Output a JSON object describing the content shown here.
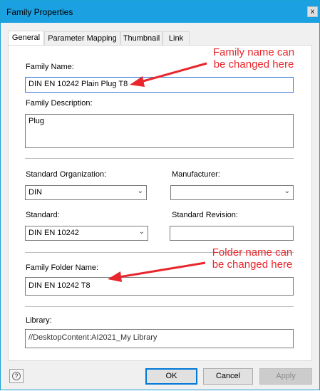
{
  "window": {
    "title": "Family Properties",
    "close_glyph": "x"
  },
  "tabs": [
    {
      "label": "General",
      "active": true
    },
    {
      "label": "Parameter Mapping",
      "active": false
    },
    {
      "label": "Thumbnail",
      "active": false
    },
    {
      "label": "Link",
      "active": false
    }
  ],
  "general": {
    "family_name_label": "Family Name:",
    "family_name_value": "DIN EN 10242 Plain Plug T8",
    "family_description_label": "Family Description:",
    "family_description_value": "Plug",
    "standard_org_label": "Standard Organization:",
    "standard_org_value": "DIN",
    "manufacturer_label": "Manufacturer:",
    "manufacturer_value": "",
    "standard_label": "Standard:",
    "standard_value": "DIN EN 10242",
    "standard_revision_label": "Standard Revision:",
    "standard_revision_value": "",
    "family_folder_label": "Family Folder Name:",
    "family_folder_value": "DIN EN 10242 T8",
    "library_label": "Library:",
    "library_value": "//DesktopContent:AI2021_My Library"
  },
  "buttons": {
    "ok": "OK",
    "cancel": "Cancel",
    "apply": "Apply",
    "help_glyph": "?"
  },
  "annotations": {
    "family_name_note_line1": "Family name can",
    "family_name_note_line2": "be changed here",
    "folder_name_note_line1": "Folder name can",
    "folder_name_note_line2": "be changed here"
  },
  "colors": {
    "titlebar": "#1ba1e2",
    "annotation": "#e8262b",
    "default_button_border": "#0078d7"
  }
}
